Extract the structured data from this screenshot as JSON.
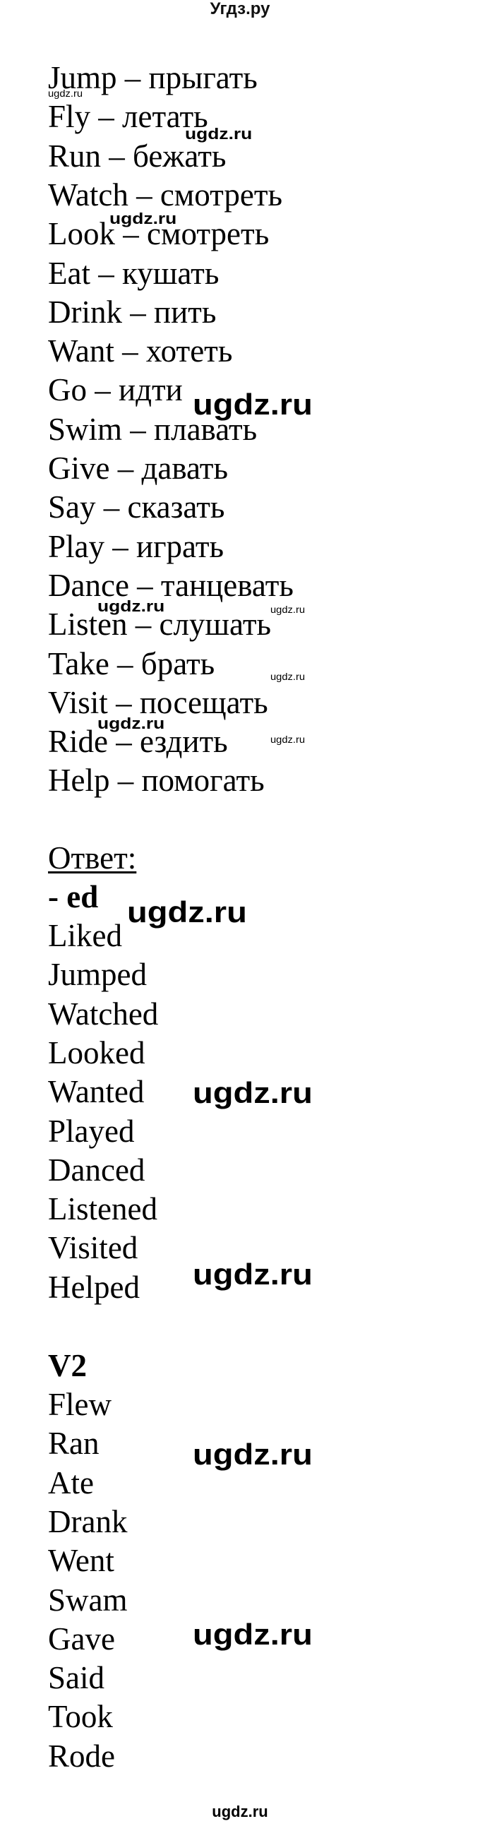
{
  "header": {
    "title": "Угдз.ру"
  },
  "vocabulary": [
    {
      "en": "Jump",
      "ru": "прыгать"
    },
    {
      "en": "Fly",
      "ru": "летать"
    },
    {
      "en": "Run",
      "ru": "бежать"
    },
    {
      "en": "Watch",
      "ru": "смотреть"
    },
    {
      "en": "Look",
      "ru": "смотреть"
    },
    {
      "en": "Eat",
      "ru": "кушать"
    },
    {
      "en": "Drink",
      "ru": "пить"
    },
    {
      "en": "Want",
      "ru": "хотеть"
    },
    {
      "en": "Go",
      "ru": "идти"
    },
    {
      "en": "Swim",
      "ru": "плавать"
    },
    {
      "en": "Give",
      "ru": "давать"
    },
    {
      "en": "Say",
      "ru": "сказать"
    },
    {
      "en": "Play",
      "ru": "играть"
    },
    {
      "en": "Dance",
      "ru": "танцевать"
    },
    {
      "en": "Listen",
      "ru": "слушать"
    },
    {
      "en": "Take",
      "ru": "брать"
    },
    {
      "en": "Visit",
      "ru": "посещать"
    },
    {
      "en": "Ride",
      "ru": "ездить"
    },
    {
      "en": "Help",
      "ru": "помогать"
    }
  ],
  "separator": " – ",
  "answer": {
    "label": "Ответ:",
    "ed_heading": "- ed",
    "ed_words": [
      "Liked",
      "Jumped",
      "Watched",
      "Looked",
      "Wanted",
      "Played",
      "Danced",
      "Listened",
      "Visited",
      "Helped"
    ],
    "v2_heading": "V2",
    "v2_words": [
      "Flew",
      "Ran",
      "Ate",
      "Drank",
      "Went",
      "Swam",
      "Gave",
      "Said",
      "Took",
      "Rode"
    ]
  },
  "watermark": {
    "text": "ugdz.ru"
  },
  "footer": {
    "text": "ugdz.ru"
  }
}
